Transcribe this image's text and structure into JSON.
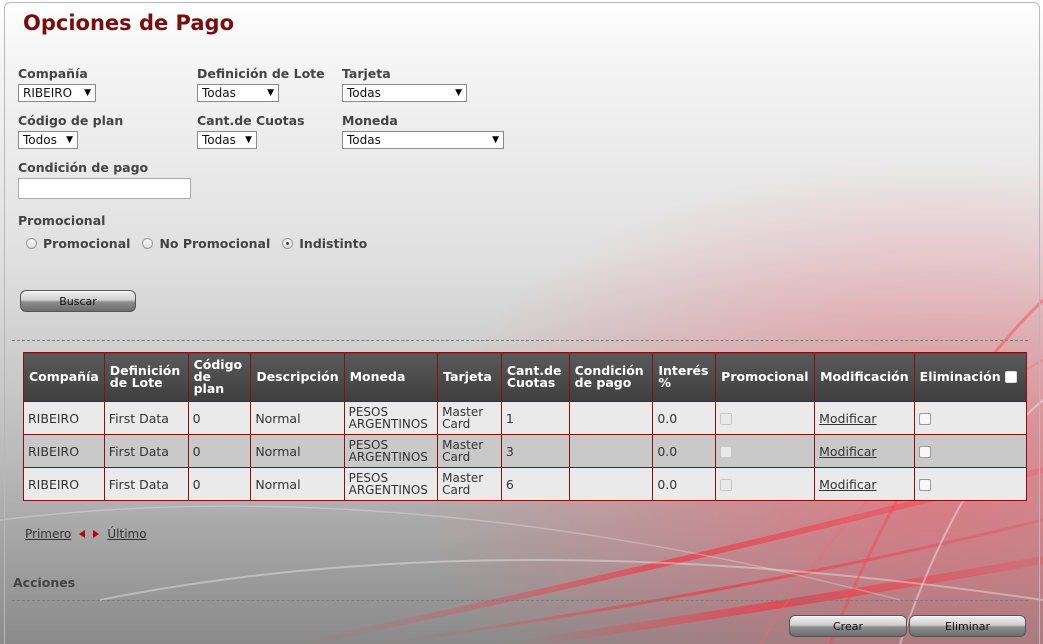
{
  "page": {
    "title": "Opciones de Pago"
  },
  "filters": {
    "compania": {
      "label": "Compañía",
      "value": "RIBEIRO"
    },
    "definicion_lote": {
      "label": "Definición de Lote",
      "value": "Todas"
    },
    "tarjeta": {
      "label": "Tarjeta",
      "value": "Todas"
    },
    "codigo_plan": {
      "label": "Código de plan",
      "value": "Todos"
    },
    "cant_cuotas": {
      "label": "Cant.de Cuotas",
      "value": "Todas"
    },
    "moneda": {
      "label": "Moneda",
      "value": "Todas"
    },
    "condicion_pago": {
      "label": "Condición de pago",
      "value": ""
    },
    "promocional": {
      "label": "Promocional",
      "options": [
        "Promocional",
        "No Promocional",
        "Indistinto"
      ],
      "selected": "Indistinto"
    }
  },
  "buttons": {
    "buscar": "Buscar",
    "crear": "Crear",
    "eliminar": "Eliminar"
  },
  "table": {
    "headers": [
      "Compañía",
      "Definición de Lote",
      "Código de plan",
      "Descripción",
      "Moneda",
      "Tarjeta",
      "Cant.de Cuotas",
      "Condición de pago",
      "Interés %",
      "Promocional",
      "Modificación",
      "Eliminación"
    ],
    "rows": [
      {
        "compania": "RIBEIRO",
        "lote": "First Data",
        "codigo": "0",
        "descripcion": "Normal",
        "moneda": "PESOS ARGENTINOS",
        "tarjeta": "Master Card",
        "cuotas": "1",
        "condicion": "",
        "interes": "0.0",
        "modificar": "Modificar"
      },
      {
        "compania": "RIBEIRO",
        "lote": "First Data",
        "codigo": "0",
        "descripcion": "Normal",
        "moneda": "PESOS ARGENTINOS",
        "tarjeta": "Master Card",
        "cuotas": "3",
        "condicion": "",
        "interes": "0.0",
        "modificar": "Modificar"
      },
      {
        "compania": "RIBEIRO",
        "lote": "First Data",
        "codigo": "0",
        "descripcion": "Normal",
        "moneda": "PESOS ARGENTINOS",
        "tarjeta": "Master Card",
        "cuotas": "6",
        "condicion": "",
        "interes": "0.0",
        "modificar": "Modificar"
      }
    ]
  },
  "pager": {
    "first": "Primero",
    "last": "Último"
  },
  "acciones": {
    "label": "Acciones"
  },
  "colors": {
    "title": "#7a0c0c",
    "table_border": "#8a1010",
    "header_bg": "#4a4a4a",
    "accent_red": "#d01020"
  }
}
